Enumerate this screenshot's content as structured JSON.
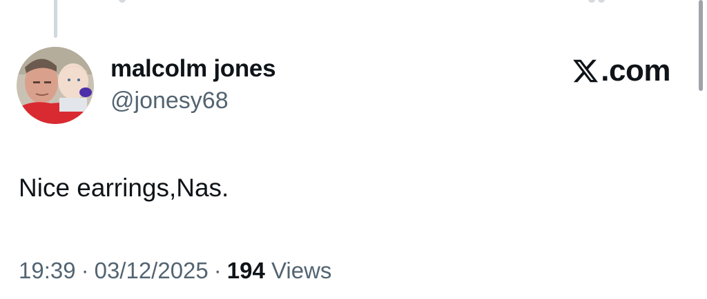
{
  "tweet": {
    "author": {
      "display_name": "malcolm jones",
      "handle": "@jonesy68",
      "avatar": "profile-photo"
    },
    "brand": {
      "logo_text": ".com",
      "logo_icon": "x-logo-icon"
    },
    "text": "Nice earrings,Nas.",
    "time": "19:39",
    "date": "03/12/2025",
    "separator": "·",
    "views_count": "194",
    "views_label": "Views"
  },
  "colors": {
    "text_primary": "#0f1419",
    "text_secondary": "#536471",
    "thread_line": "#cfd9de"
  }
}
